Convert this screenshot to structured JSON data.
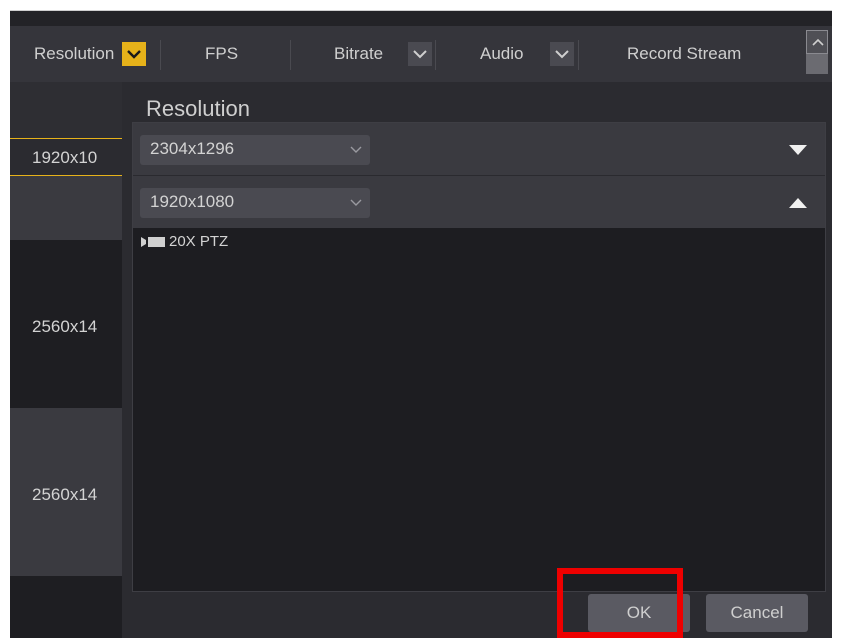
{
  "header": {
    "columns": [
      {
        "label": "Resolution",
        "dropdown_active": true
      },
      {
        "label": "FPS"
      },
      {
        "label": "Bitrate",
        "dropdown_active": false
      },
      {
        "label": "Audio",
        "dropdown_active": false
      },
      {
        "label": "Record Stream"
      }
    ]
  },
  "left_column": {
    "rows": [
      "1920x10",
      "2560x14",
      "2560x14"
    ]
  },
  "modal": {
    "title": "Resolution",
    "rows": [
      {
        "value": "2304x1296",
        "expand_icon": "triangle-down-icon"
      },
      {
        "value": "1920x1080",
        "expand_icon": "triangle-up-icon"
      }
    ],
    "camera_item": {
      "label": "20X PTZ",
      "icon": "camera-icon"
    },
    "ok_label": "OK",
    "cancel_label": "Cancel"
  },
  "colors": {
    "accent_yellow": "#e6b21a",
    "highlight_red": "#ee0000",
    "background": "#232327"
  }
}
